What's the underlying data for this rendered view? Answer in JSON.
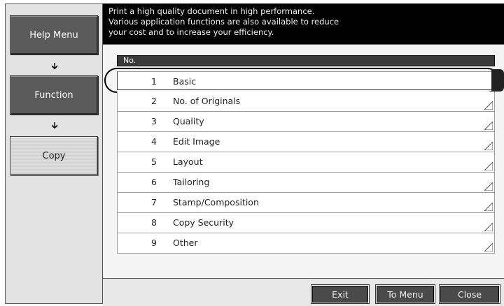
{
  "sidebar": {
    "items": [
      {
        "label": "Help Menu"
      },
      {
        "label": "Function"
      },
      {
        "label": "Copy"
      }
    ],
    "arrow_icon": "down-arrow-icon"
  },
  "message": {
    "lines": [
      "Print a high quality document in high performance.",
      "Various application functions are also available to reduce",
      "your cost and to increase your efficiency."
    ]
  },
  "table": {
    "header": "No.",
    "rows": [
      {
        "num": "1",
        "label": "Basic"
      },
      {
        "num": "2",
        "label": "No. of Originals"
      },
      {
        "num": "3",
        "label": "Quality"
      },
      {
        "num": "4",
        "label": "Edit Image"
      },
      {
        "num": "5",
        "label": "Layout"
      },
      {
        "num": "6",
        "label": "Tailoring"
      },
      {
        "num": "7",
        "label": "Stamp/Composition"
      },
      {
        "num": "8",
        "label": "Copy Security"
      },
      {
        "num": "9",
        "label": "Other"
      }
    ],
    "selected_index": 0
  },
  "footer": {
    "exit_label": "Exit",
    "to_menu_label": "To Menu",
    "close_label": "Close"
  }
}
